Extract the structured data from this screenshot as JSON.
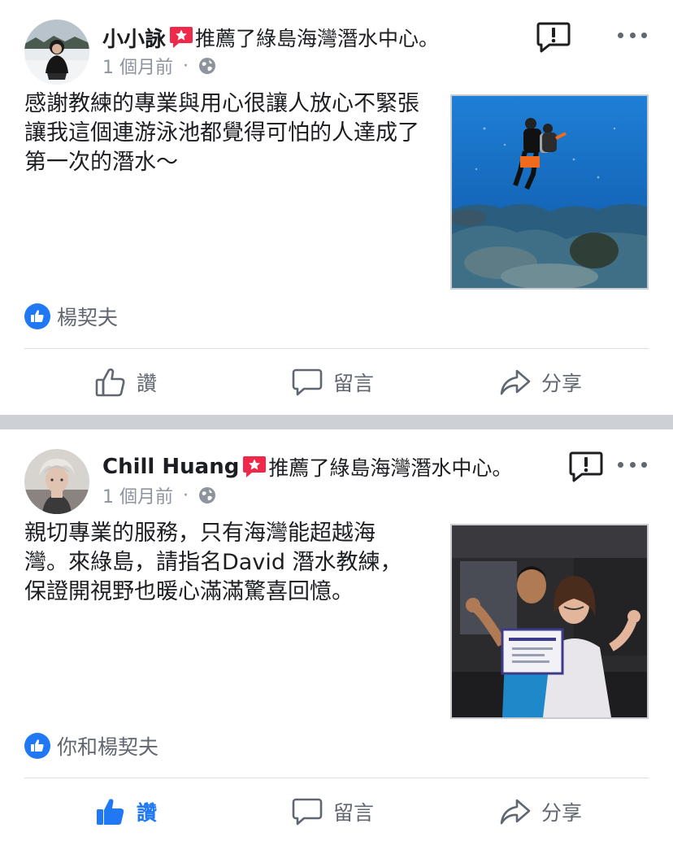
{
  "posts": [
    {
      "author": "小小詠",
      "recommend_text": "推薦了綠島海灣潛水中心。",
      "time": "1 個月前",
      "separator": "·",
      "body": "感謝教練的專業與用心很讓人放心不緊張讓我這個連游泳池都覺得可怕的人達成了第一次的潛水～",
      "likes": "楊契夫",
      "actions": {
        "like": "讚",
        "comment": "留言",
        "share": "分享"
      },
      "liked": false
    },
    {
      "author": "Chill Huang",
      "recommend_text": "推薦了綠島海灣潛水中心。",
      "time": "1 個月前",
      "separator": "·",
      "body": "親切專業的服務，只有海灣能超越海灣。來綠島，請指名David 潛水教練，保證開視野也暖心滿滿驚喜回憶。",
      "likes": "你和楊契夫",
      "actions": {
        "like": "讚",
        "comment": "留言",
        "share": "分享"
      },
      "liked": true
    }
  ],
  "colors": {
    "accent": "#2078f4",
    "recommend_badge": "#f0284a",
    "muted_text": "#606770",
    "meta_text": "#8d949e",
    "divider": "#cdd0d5"
  },
  "icons": {
    "recommend": "recommend-star-badge-icon",
    "privacy": "globe-icon",
    "report": "report-icon",
    "more": "more-options-icon",
    "like": "thumbs-up-icon",
    "comment": "comment-bubble-icon",
    "share": "share-arrow-icon"
  }
}
